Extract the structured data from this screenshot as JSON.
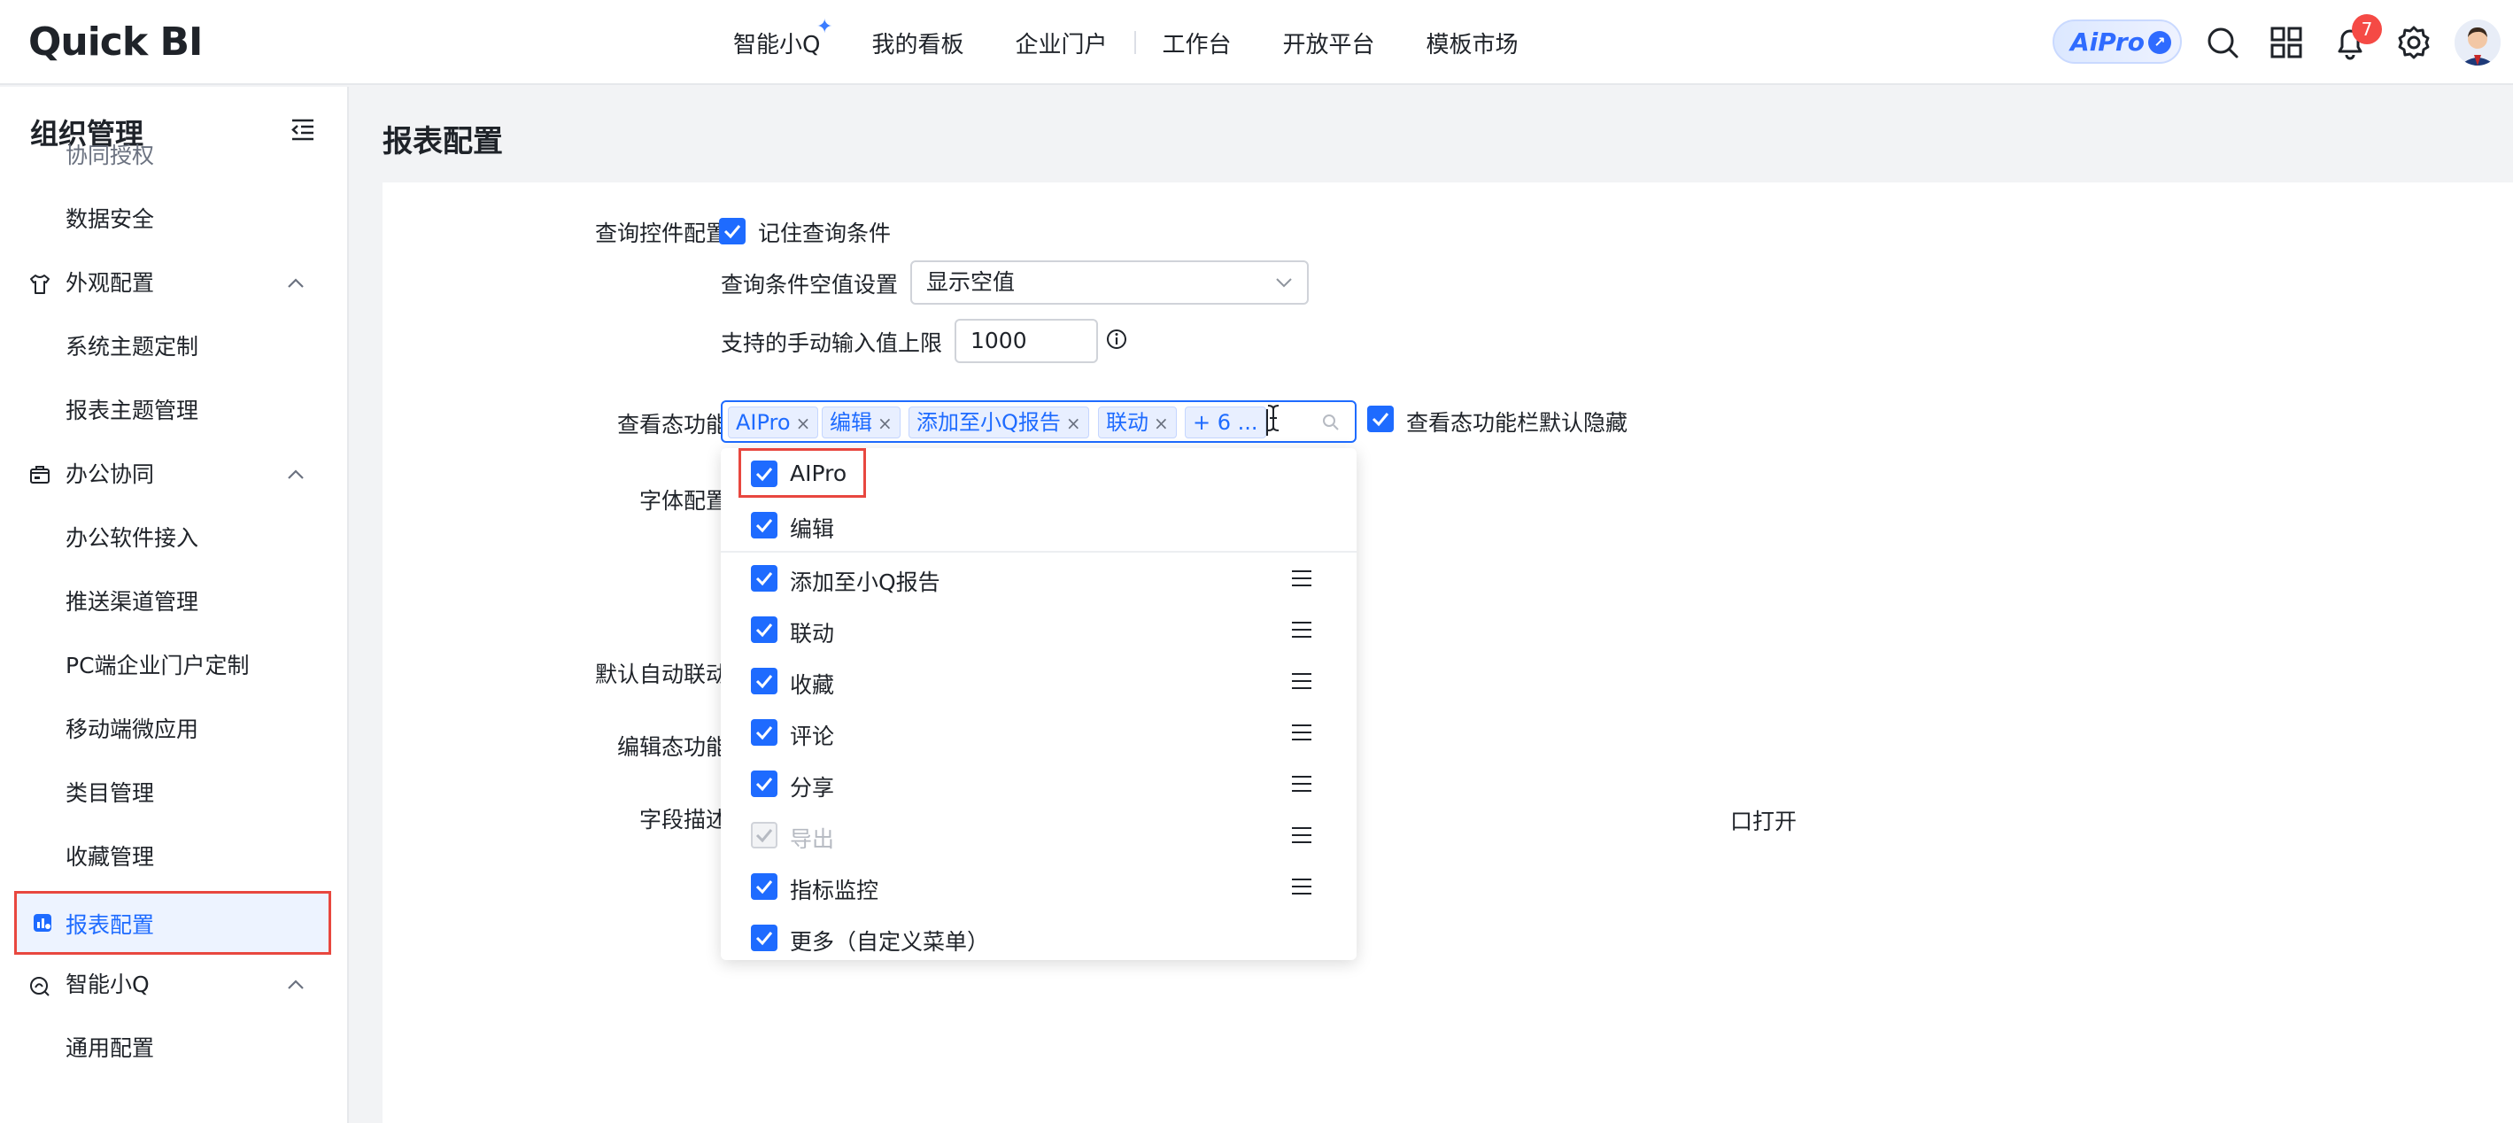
{
  "header": {
    "logo": "Quick BI",
    "nav": [
      "智能小Q",
      "我的看板",
      "企业门户",
      "工作台",
      "开放平台",
      "模板市场"
    ],
    "aipro_badge": "AiPro",
    "notification_count": "7"
  },
  "sidebar": {
    "title": "组织管理",
    "items": [
      {
        "label": "协同授权",
        "type": "child"
      },
      {
        "label": "数据安全",
        "type": "child"
      },
      {
        "label": "外观配置",
        "type": "group",
        "icon": "shirt-icon"
      },
      {
        "label": "系统主题定制",
        "type": "child"
      },
      {
        "label": "报表主题管理",
        "type": "child"
      },
      {
        "label": "办公协同",
        "type": "group",
        "icon": "office-icon"
      },
      {
        "label": "办公软件接入",
        "type": "child"
      },
      {
        "label": "推送渠道管理",
        "type": "child"
      },
      {
        "label": "PC端企业门户定制",
        "type": "child"
      },
      {
        "label": "移动端微应用",
        "type": "child"
      },
      {
        "label": "类目管理",
        "type": "child"
      },
      {
        "label": "收藏管理",
        "type": "child"
      },
      {
        "label": "报表配置",
        "type": "active",
        "icon": "report-config-icon"
      },
      {
        "label": "智能小Q",
        "type": "group",
        "icon": "ai-q-icon"
      },
      {
        "label": "通用配置",
        "type": "child"
      }
    ]
  },
  "main": {
    "title": "报表配置",
    "query_control": {
      "label": "查询控件配置",
      "remember_label": "记住查询条件",
      "remember_checked": true,
      "empty_setting_label": "查询条件空值设置",
      "empty_setting_value": "显示空值",
      "manual_limit_label": "支持的手动输入值上限",
      "manual_limit_value": "1000"
    },
    "view_functions": {
      "label": "查看态功能",
      "tags": [
        "AIPro",
        "编辑",
        "添加至小Q报告",
        "联动",
        "+ 6 ..."
      ],
      "hide_label": "查看态功能栏默认隐藏",
      "hide_checked": true
    },
    "font_config_label": "字体配置",
    "auto_link_label": "默认自动联动",
    "edit_functions_label": "编辑态功能",
    "field_desc_label": "字段描述",
    "field_desc_partial_text": "口打开",
    "dropdown_options": [
      {
        "label": "AIPro",
        "checked": true,
        "draggable": false,
        "highlight": true
      },
      {
        "label": "编辑",
        "checked": true,
        "draggable": false
      },
      {
        "label": "添加至小Q报告",
        "checked": true,
        "draggable": true
      },
      {
        "label": "联动",
        "checked": true,
        "draggable": true
      },
      {
        "label": "收藏",
        "checked": true,
        "draggable": true
      },
      {
        "label": "评论",
        "checked": true,
        "draggable": true
      },
      {
        "label": "分享",
        "checked": true,
        "draggable": true
      },
      {
        "label": "导出",
        "checked": true,
        "draggable": true,
        "disabled": true
      },
      {
        "label": "指标监控",
        "checked": true,
        "draggable": true
      },
      {
        "label": "更多（自定义菜单）",
        "checked": true,
        "draggable": false
      }
    ]
  },
  "colors": {
    "primary": "#1e6bff",
    "highlight_border": "#e8473f",
    "badge": "#f54a45"
  }
}
